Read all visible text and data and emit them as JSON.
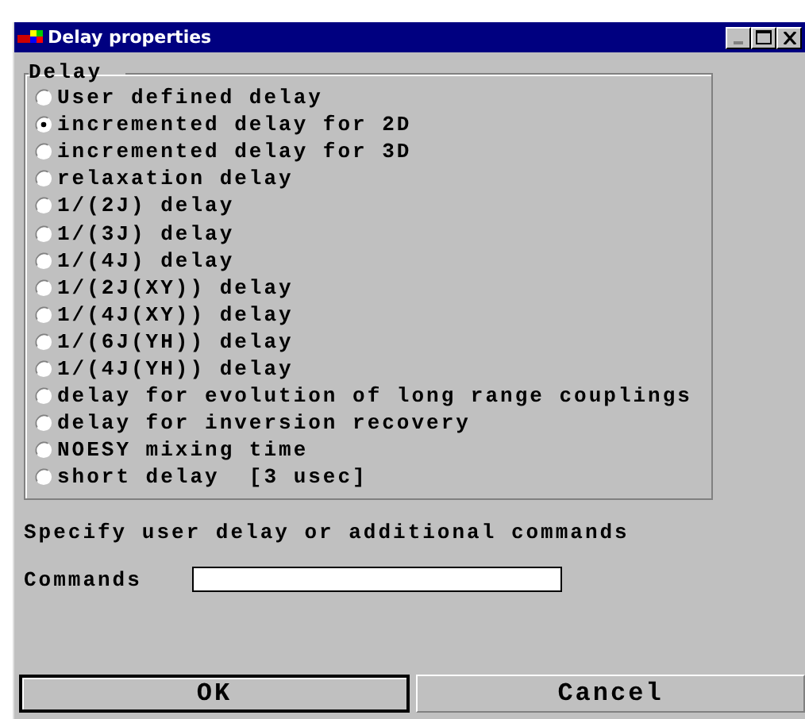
{
  "window": {
    "title": "Delay properties",
    "controls": [
      {
        "kind": "minimize",
        "disabled": true
      },
      {
        "kind": "maximize",
        "disabled": false
      },
      {
        "kind": "close",
        "disabled": false
      }
    ]
  },
  "group": {
    "label": "Delay",
    "options": [
      {
        "label": "User defined delay",
        "selected": false
      },
      {
        "label": "incremented delay for 2D",
        "selected": true
      },
      {
        "label": "incremented delay for 3D",
        "selected": false
      },
      {
        "label": "relaxation delay",
        "selected": false
      },
      {
        "label": "1/(2J) delay",
        "selected": false
      },
      {
        "label": "1/(3J) delay",
        "selected": false
      },
      {
        "label": "1/(4J) delay",
        "selected": false
      },
      {
        "label": "1/(2J(XY)) delay",
        "selected": false
      },
      {
        "label": "1/(4J(XY)) delay",
        "selected": false
      },
      {
        "label": "1/(6J(YH)) delay",
        "selected": false
      },
      {
        "label": "1/(4J(YH)) delay",
        "selected": false
      },
      {
        "label": "delay for evolution of long range couplings",
        "selected": false
      },
      {
        "label": "delay for inversion recovery",
        "selected": false
      },
      {
        "label": "NOESY mixing time",
        "selected": false
      },
      {
        "label": "short delay  [3 usec]",
        "selected": false
      }
    ]
  },
  "prompt": "Specify user delay or additional commands",
  "commands": {
    "label": "Commands"
  },
  "buttons": [
    {
      "label": "OK",
      "default": true
    },
    {
      "label": "Cancel",
      "default": false
    }
  ]
}
